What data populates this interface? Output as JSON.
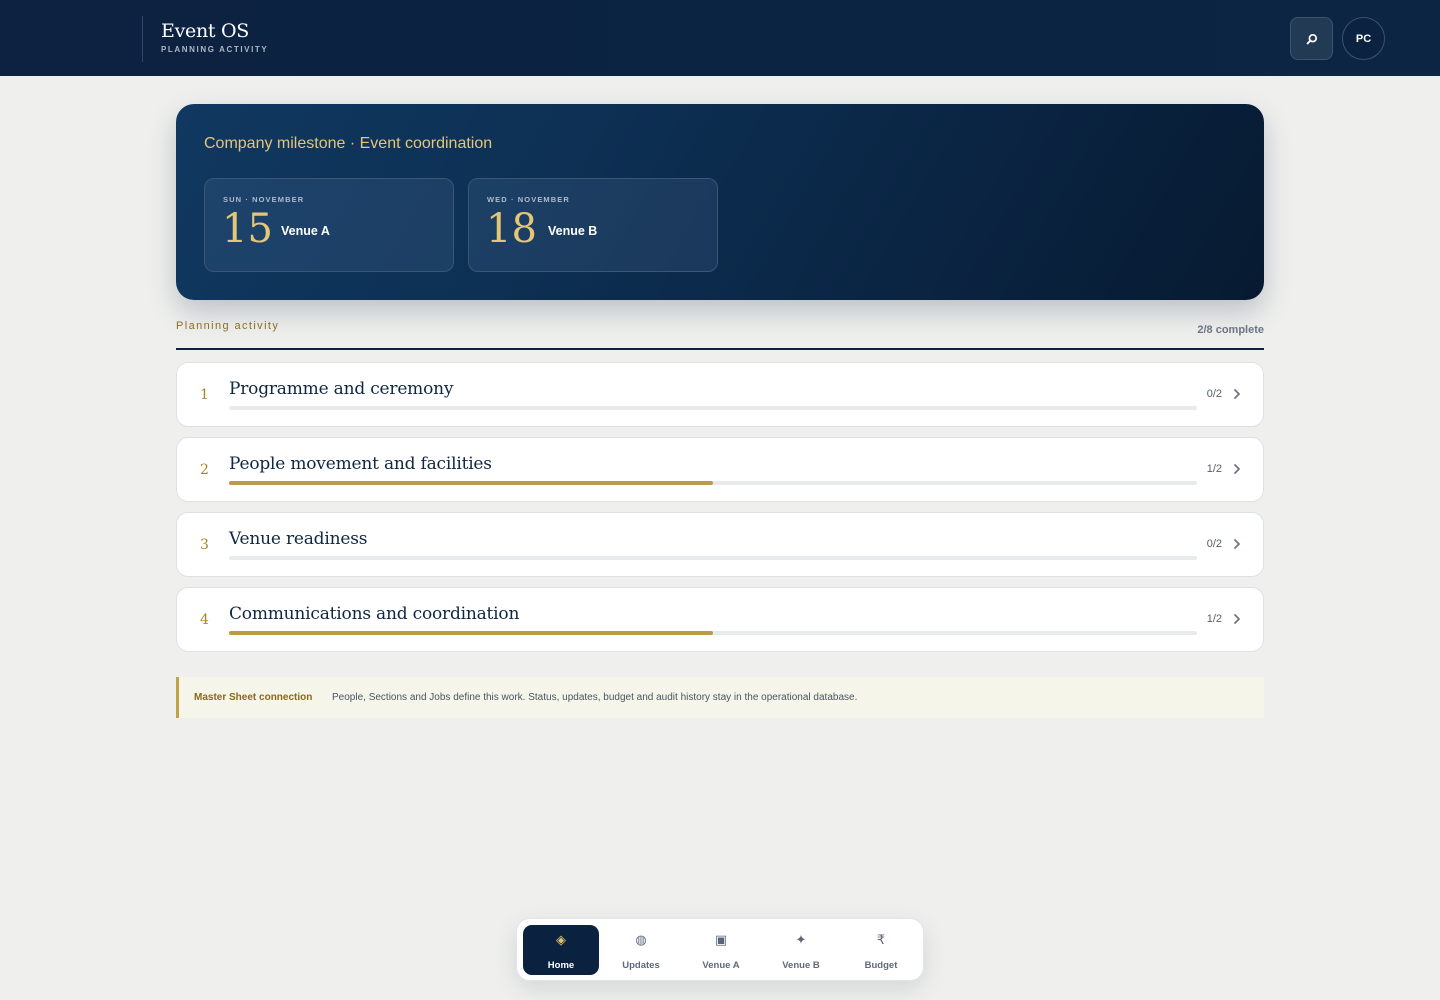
{
  "header": {
    "title": "Event OS",
    "subtitle": "PLANNING ACTIVITY",
    "search_icon": "search-icon",
    "avatar_initials": "PC"
  },
  "hero": {
    "title": "Company milestone · Event coordination",
    "dates": [
      {
        "label": "SUN · NOVEMBER",
        "day": "15",
        "venue": "Venue A"
      },
      {
        "label": "WED · NOVEMBER",
        "day": "18",
        "venue": "Venue B"
      }
    ]
  },
  "planning": {
    "label": "Planning activity",
    "summary": "2/8 complete",
    "rows": [
      {
        "num": "1",
        "title": "Programme and ceremony",
        "count": "0/2",
        "progress": 0
      },
      {
        "num": "2",
        "title": "People movement and facilities",
        "count": "1/2",
        "progress": 0.5
      },
      {
        "num": "3",
        "title": "Venue readiness",
        "count": "0/2",
        "progress": 0
      },
      {
        "num": "4",
        "title": "Communications and coordination",
        "count": "1/2",
        "progress": 0.5
      }
    ]
  },
  "note": {
    "label": "Master Sheet connection",
    "text": "People, Sections and Jobs define this work. Status, updates, budget and audit history stay in the operational database."
  },
  "nav": {
    "items": [
      {
        "label": "Home",
        "icon": "◈",
        "icon_name": "home-diamond-icon",
        "active": true
      },
      {
        "label": "Updates",
        "icon": "◍",
        "icon_name": "updates-icon",
        "active": false
      },
      {
        "label": "Venue A",
        "icon": "▣",
        "icon_name": "venue-a-icon",
        "active": false
      },
      {
        "label": "Venue B",
        "icon": "✦",
        "icon_name": "venue-b-icon",
        "active": false
      },
      {
        "label": "Budget",
        "icon": "₹",
        "icon_name": "rupee-icon",
        "active": false
      }
    ]
  },
  "colors": {
    "navy": "#0c2240",
    "gold": "#bd9a45",
    "accent_text": "#e4c679"
  }
}
